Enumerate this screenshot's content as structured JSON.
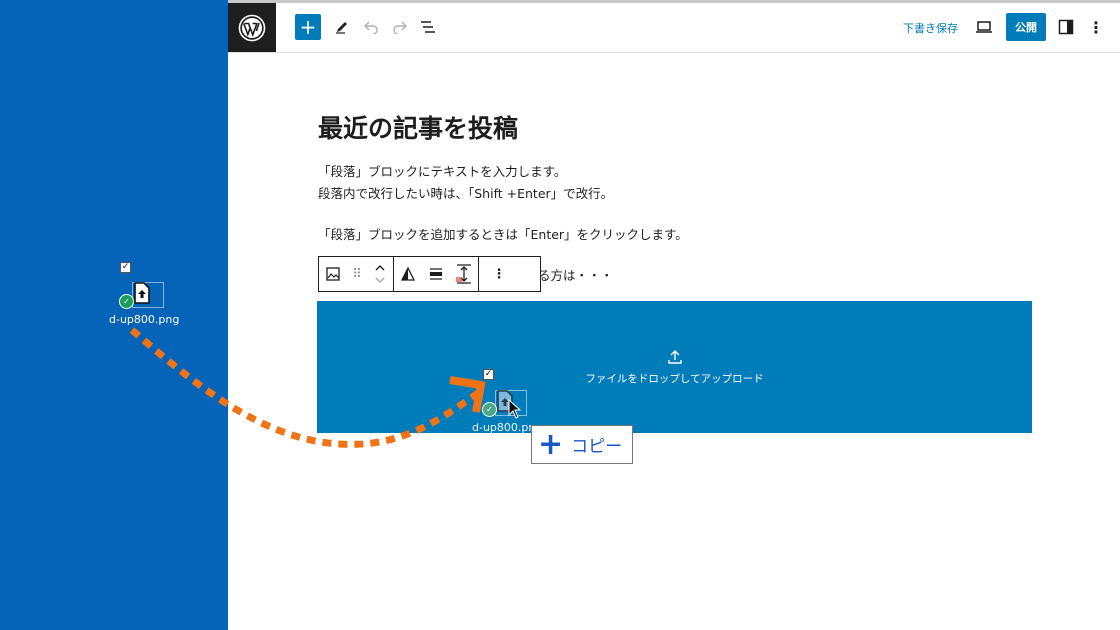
{
  "toolbar": {
    "draft_label": "下書き保存",
    "publish_label": "公開"
  },
  "post": {
    "title": "最近の記事を投稿",
    "paragraphs": [
      "「段落」ブロックにテキストを入力します。",
      "段落内で改行したい時は、「Shift +Enter」で改行。",
      "「段落」ブロックを追加するときは「Enter」をクリックします。",
      "る方は・・・"
    ]
  },
  "dropzone": {
    "label": "ファイルをドロップしてアップロード"
  },
  "desktop_file": {
    "name": "d-up800.png"
  },
  "dragged_file": {
    "name": "d-up800.png"
  },
  "drag_tooltip": {
    "label": "コピー"
  },
  "colors": {
    "accent": "#007cba",
    "desktop": "#0563b8",
    "arrow": "#f07316"
  },
  "icons": {
    "wp_logo": "wordpress-logo-icon",
    "add": "plus-icon",
    "edit": "pencil-icon",
    "undo": "undo-icon",
    "redo": "redo-icon",
    "outline": "list-view-icon",
    "preview": "laptop-icon",
    "settings": "sidebar-icon",
    "more": "more-vertical-icon"
  }
}
